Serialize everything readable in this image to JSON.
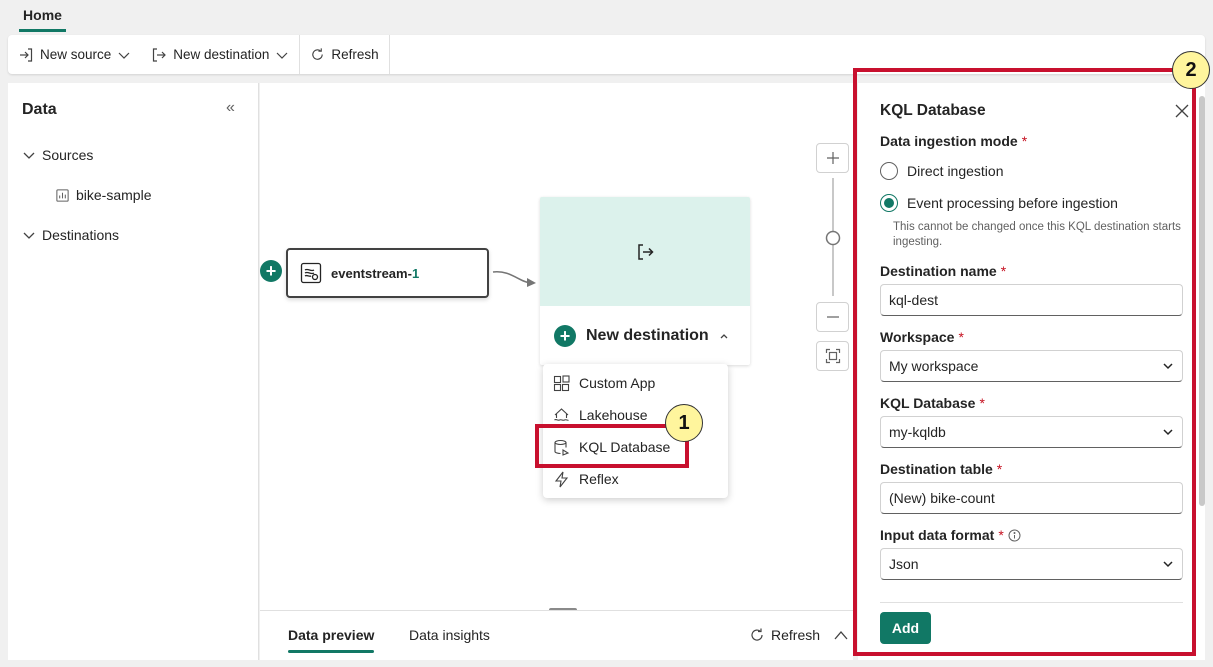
{
  "tabs": {
    "home": "Home"
  },
  "toolbar": {
    "new_source": "New source",
    "new_destination": "New destination",
    "refresh": "Refresh"
  },
  "left_panel": {
    "title": "Data",
    "sources_label": "Sources",
    "source_item": "bike-sample",
    "destinations_label": "Destinations"
  },
  "canvas": {
    "source_node": {
      "name_prefix": "eventstream-",
      "name_suffix": "1"
    },
    "dest_node": {
      "label": "New destination"
    },
    "menu": {
      "items": [
        "Custom App",
        "Lakehouse",
        "KQL Database",
        "Reflex"
      ]
    }
  },
  "bottom": {
    "data_preview": "Data preview",
    "data_insights": "Data insights",
    "refresh": "Refresh"
  },
  "panel": {
    "title": "KQL Database",
    "ingestion_mode_label": "Data ingestion mode",
    "required_mark": "*",
    "option_direct": "Direct ingestion",
    "option_event": "Event processing before ingestion",
    "selected_option": "Event processing before ingestion",
    "help_text": "This cannot be changed once this KQL destination starts ingesting.",
    "destination_name_label": "Destination name",
    "destination_name_value": "kql-dest",
    "workspace_label": "Workspace",
    "workspace_value": "My workspace",
    "kql_database_label": "KQL Database",
    "kql_database_value": "my-kqldb",
    "destination_table_label": "Destination table",
    "destination_table_value": "(New) bike-count",
    "input_format_label": "Input data format",
    "input_format_value": "Json",
    "add_button": "Add"
  },
  "callouts": {
    "one": "1",
    "two": "2"
  },
  "colors": {
    "accent": "#117865",
    "callout_red": "#c8102e",
    "badge_yellow": "#fff59d"
  }
}
